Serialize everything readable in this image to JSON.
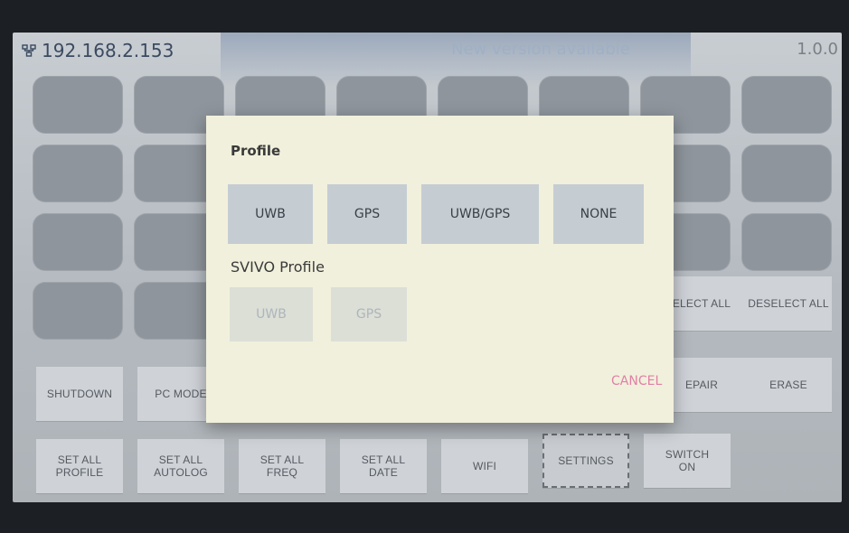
{
  "status": {
    "ip": "192.168.2.153",
    "update_notice": "New version available",
    "version": "1.0.0"
  },
  "buttons": {
    "select_all": "ELECT ALL",
    "deselect_all": "DESELECT ALL",
    "shutdown": "SHUTDOWN",
    "pc_mode": "PC MODE",
    "repair": "EPAIR",
    "erase": "ERASE",
    "set_all_profile": "SET ALL\nPROFILE",
    "set_all_autolog": "SET ALL\nAUTOLOG",
    "set_all_freq": "SET ALL\nFREQ",
    "set_all_date": "SET ALL\nDATE",
    "wifi": "WIFI",
    "settings": "SETTINGS",
    "switch_on": "SWITCH\nON"
  },
  "dialog": {
    "title": "Profile",
    "options": [
      "UWB",
      "GPS",
      "UWB/GPS",
      "NONE"
    ],
    "svivo_title": "SVIVO Profile",
    "svivo_options": [
      "UWB",
      "GPS"
    ],
    "cancel": "CANCEL"
  },
  "colors": {
    "dialog_bg": "#f1f0dc",
    "cancel": "#e17fa6",
    "option_bg": "#c5cdd3",
    "disabled_text": "#aeb5bb"
  }
}
